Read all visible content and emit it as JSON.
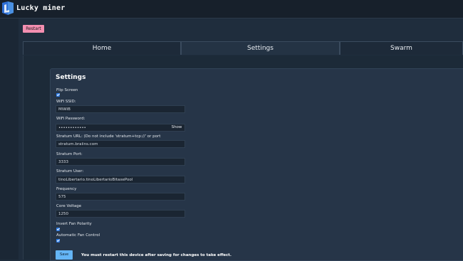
{
  "header": {
    "brand": "Lucky miner",
    "logo_icon": "lucky-miner-logo-icon"
  },
  "toolbar": {
    "restart_label": "Restart"
  },
  "tabs": [
    {
      "label": "Home",
      "active": false
    },
    {
      "label": "Settings",
      "active": true
    },
    {
      "label": "Swarm",
      "active": false
    }
  ],
  "settings": {
    "title": "Settings",
    "flip_screen": {
      "label": "Flip Screen",
      "checked": true
    },
    "wifi_ssid": {
      "label": "WiFi SSID:",
      "value": "MiWiB"
    },
    "wifi_password": {
      "label": "WiFi Password:",
      "value": "••••••••••••",
      "show_label": "Show"
    },
    "stratum_url": {
      "label": "Stratum URL: (Do not include 'stratum+tcp://' or port",
      "value": "stratum.braiins.com"
    },
    "stratum_port": {
      "label": "Stratum Port:",
      "value": "3333"
    },
    "stratum_user": {
      "label": "Stratum User:",
      "value": "tinoLibertario.tinoLibertarioBitaxePool"
    },
    "frequency": {
      "label": "Frequency",
      "value": "575"
    },
    "core_voltage": {
      "label": "Core Voltage",
      "value": "1250"
    },
    "invert_fan_polarity": {
      "label": "Invert Fan Polarity",
      "checked": true
    },
    "automatic_fan_control": {
      "label": "Automatic Fan Control",
      "checked": true
    },
    "save_label": "Save",
    "restart_note": "You must restart this device after saving for changes to take effect."
  },
  "colors": {
    "accent_blue": "#64b5f6",
    "restart_pink": "#f48fb1",
    "checkbox_blue": "#2d7be5",
    "background": "#1f2d3d"
  }
}
